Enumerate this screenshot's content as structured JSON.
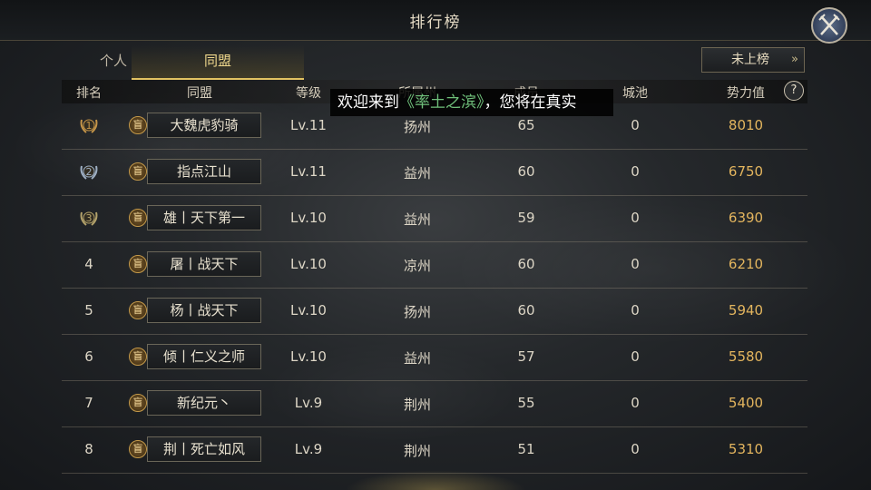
{
  "window": {
    "title": "排行榜"
  },
  "tabs": [
    {
      "label": "个人",
      "active": false
    },
    {
      "label": "同盟",
      "active": true
    }
  ],
  "unranked_button": {
    "label": "未上榜",
    "chevron": "»"
  },
  "columns": {
    "rank": "排名",
    "alliance": "同盟",
    "level": "等级",
    "state": "所属州",
    "members": "成员",
    "cities": "城池",
    "power": "势力值",
    "help": "?"
  },
  "banner": {
    "prefix": "欢迎来到",
    "highlight": "《率土之滨》",
    "suffix": "，您将在真实"
  },
  "rows": [
    {
      "rank": "1",
      "flag": "盲",
      "alliance": "大魏虎豹骑",
      "level": "Lv.11",
      "state": "扬州",
      "members": "65",
      "cities": "0",
      "power": "8010"
    },
    {
      "rank": "2",
      "flag": "盲",
      "alliance": "指点江山",
      "level": "Lv.11",
      "state": "益州",
      "members": "60",
      "cities": "0",
      "power": "6750"
    },
    {
      "rank": "3",
      "flag": "盲",
      "alliance": "雄丨天下第一",
      "level": "Lv.10",
      "state": "益州",
      "members": "59",
      "cities": "0",
      "power": "6390"
    },
    {
      "rank": "4",
      "flag": "盲",
      "alliance": "屠丨战天下",
      "level": "Lv.10",
      "state": "凉州",
      "members": "60",
      "cities": "0",
      "power": "6210"
    },
    {
      "rank": "5",
      "flag": "盲",
      "alliance": "杨丨战天下",
      "level": "Lv.10",
      "state": "扬州",
      "members": "60",
      "cities": "0",
      "power": "5940"
    },
    {
      "rank": "6",
      "flag": "盲",
      "alliance": "倾丨仁义之师",
      "level": "Lv.10",
      "state": "益州",
      "members": "57",
      "cities": "0",
      "power": "5580"
    },
    {
      "rank": "7",
      "flag": "盲",
      "alliance": "新纪元丶",
      "level": "Lv.9",
      "state": "荆州",
      "members": "55",
      "cities": "0",
      "power": "5400"
    },
    {
      "rank": "8",
      "flag": "盲",
      "alliance": "荆丨死亡如风",
      "level": "Lv.9",
      "state": "荆州",
      "members": "51",
      "cities": "0",
      "power": "5310"
    }
  ],
  "icons": {
    "close": "crossed-swords-icon",
    "rank_badge": "laurel-badge-icon"
  },
  "colors": {
    "accent": "#e2c262",
    "power": "#e3b55e",
    "banner_highlight": "#6fbf7a"
  }
}
